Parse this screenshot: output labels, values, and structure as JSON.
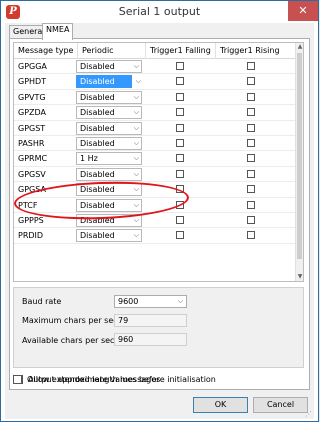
{
  "window": {
    "title": "Serial 1 output",
    "close_glyph": "✕",
    "app_icon": "P"
  },
  "tabs": [
    {
      "label": "General"
    },
    {
      "label": "NMEA"
    }
  ],
  "grid": {
    "columns": [
      "Message type",
      "Periodic",
      "Trigger1 Falling",
      "Trigger1 Rising"
    ],
    "rows": [
      {
        "type": "GPGGA",
        "periodic": "Disabled"
      },
      {
        "type": "GPHDT",
        "periodic": "Disabled"
      },
      {
        "type": "GPVTG",
        "periodic": "Disabled"
      },
      {
        "type": "GPZDA",
        "periodic": "Disabled"
      },
      {
        "type": "GPGST",
        "periodic": "Disabled"
      },
      {
        "type": "PASHR",
        "periodic": "Disabled"
      },
      {
        "type": "GPRMC",
        "periodic": "1 Hz"
      },
      {
        "type": "GPGSV",
        "periodic": "Disabled"
      },
      {
        "type": "GPGSA",
        "periodic": "Disabled"
      },
      {
        "type": "PTCF",
        "periodic": "Disabled"
      },
      {
        "type": "GPPPS",
        "periodic": "Disabled"
      },
      {
        "type": "PRDID",
        "periodic": "Disabled"
      }
    ]
  },
  "settings": {
    "baud_label": "Baud rate",
    "baud_value": "9600",
    "max_chars_label": "Maximum chars per second",
    "max_chars_value": "79",
    "avail_chars_label": "Available chars per second",
    "avail_chars_value": "960"
  },
  "options": {
    "extended_label": "Allow extended length messages",
    "approx_label": "Output approximate values before initialisation"
  },
  "buttons": {
    "ok": "OK",
    "cancel": "Cancel"
  },
  "colors": {
    "highlight_ellipse": "#e0141a",
    "selection": "#3399ff"
  }
}
